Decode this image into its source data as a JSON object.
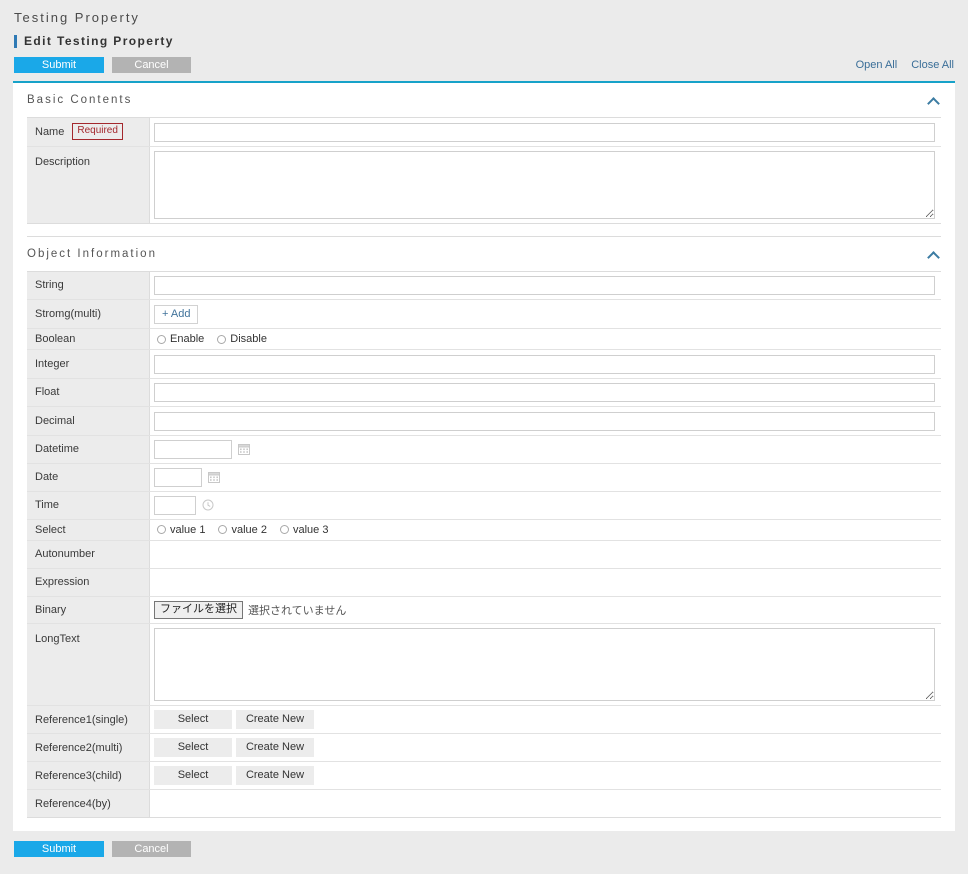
{
  "header": {
    "app_title": "Testing Property",
    "sub_title": "Edit Testing Property"
  },
  "actions": {
    "submit_label": "Submit",
    "cancel_label": "Cancel",
    "open_all_label": "Open All",
    "close_all_label": "Close All"
  },
  "accent_colors": {
    "submit_blue": "#1aa8e8",
    "cancel_gray": "#b3b3b3",
    "card_top_rule": "#17a2c9",
    "required_red": "#a4282d",
    "link_blue": "#3a6e98",
    "chevron_blue": "#3c7ca3"
  },
  "sections": [
    {
      "title": "Basic Contents",
      "collapse_icon": "chevron-up-icon",
      "rows": [
        {
          "label": "Name",
          "badge": "Required",
          "field": "text",
          "value": "",
          "placeholder": ""
        },
        {
          "label": "Description",
          "field": "textarea",
          "value": "",
          "placeholder": ""
        }
      ]
    },
    {
      "title": "Object Information",
      "collapse_icon": "chevron-up-icon",
      "rows": [
        {
          "label": "String",
          "field": "text",
          "value": "",
          "placeholder": ""
        },
        {
          "label": "Stromg(multi)",
          "field": "add-button",
          "add_label": "+ Add"
        },
        {
          "label": "Boolean",
          "field": "radio",
          "options": [
            "Enable",
            "Disable"
          ]
        },
        {
          "label": "Integer",
          "field": "text",
          "value": "",
          "placeholder": ""
        },
        {
          "label": "Float",
          "field": "text",
          "value": "",
          "placeholder": ""
        },
        {
          "label": "Decimal",
          "field": "text",
          "value": "",
          "placeholder": ""
        },
        {
          "label": "Datetime",
          "field": "datetime",
          "value": "",
          "icon": "calendar-icon"
        },
        {
          "label": "Date",
          "field": "date",
          "value": "",
          "icon": "calendar-icon"
        },
        {
          "label": "Time",
          "field": "time",
          "value": "",
          "icon": "clock-icon"
        },
        {
          "label": "Select",
          "field": "radio",
          "options": [
            "value 1",
            "value 2",
            "value 3"
          ]
        },
        {
          "label": "Autonumber",
          "field": "readonly",
          "value": ""
        },
        {
          "label": "Expression",
          "field": "readonly",
          "value": ""
        },
        {
          "label": "Binary",
          "field": "file",
          "button_label": "ファイルを選択",
          "status_text": "選択されていません"
        },
        {
          "label": "LongText",
          "field": "textarea",
          "value": "",
          "placeholder": ""
        },
        {
          "label": "Reference1(single)",
          "field": "reference",
          "select_label": "Select",
          "create_label": "Create New"
        },
        {
          "label": "Reference2(multi)",
          "field": "reference",
          "select_label": "Select",
          "create_label": "Create New"
        },
        {
          "label": "Reference3(child)",
          "field": "reference",
          "select_label": "Select",
          "create_label": "Create New"
        },
        {
          "label": "Reference4(by)",
          "field": "readonly",
          "value": ""
        }
      ]
    }
  ],
  "bottom_actions": {
    "submit_label": "Submit",
    "cancel_label": "Cancel"
  }
}
